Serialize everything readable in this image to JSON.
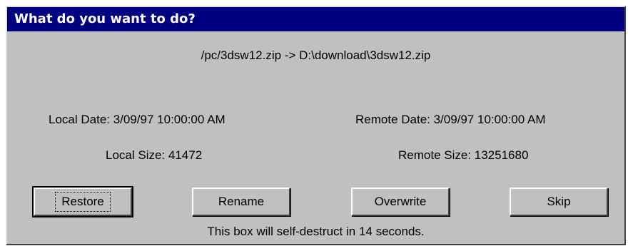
{
  "window": {
    "title": "What do you want to do?"
  },
  "transfer": {
    "path": "/pc/3dsw12.zip -> D:\\download\\3dsw12.zip"
  },
  "local": {
    "date": "Local Date: 3/09/97 10:00:00 AM",
    "size": "Local Size: 41472"
  },
  "remote": {
    "date": "Remote Date: 3/09/97 10:00:00 AM",
    "size": "Remote Size: 13251680"
  },
  "buttons": {
    "restore": "Restore",
    "rename": "Rename",
    "overwrite": "Overwrite",
    "skip": "Skip"
  },
  "status": {
    "countdown": "This box will self-destruct in 14 seconds."
  },
  "colors": {
    "titlebar": "#000080",
    "face": "#c0c0c0",
    "titletext": "#ffffff"
  }
}
